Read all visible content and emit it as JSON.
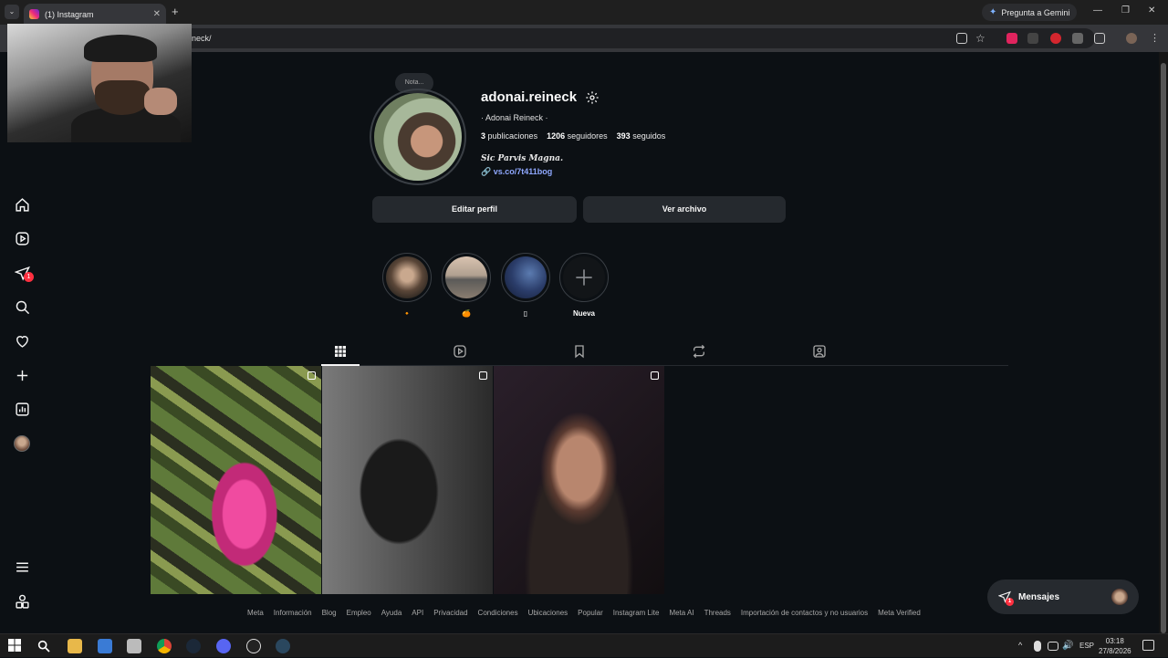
{
  "browser": {
    "tab_title": "(1) Instagram",
    "tab_close": "✕",
    "new_tab": "+",
    "gemini_label": "Pregunta a Gemini",
    "url": "neck/",
    "window_min": "—",
    "window_max": "❐",
    "window_close": "✕"
  },
  "nav": {
    "messages_badge": "1"
  },
  "profile": {
    "note": "Nota...",
    "username": "adonai.reineck",
    "full_name": "· Adonai Reineck ·",
    "posts_count": "3",
    "posts_label": "publicaciones",
    "followers_count": "1206",
    "followers_label": "seguidores",
    "following_count": "393",
    "following_label": "seguidos",
    "bio": "Sic Parvis Magna.",
    "link": "vs.co/7t411bog",
    "edit_button": "Editar perfil",
    "archive_button": "Ver archivo"
  },
  "highlights": [
    {
      "label": "🔸",
      "color": "#e05a2b"
    },
    {
      "label": "🍊",
      "color": "#c77a3a"
    },
    {
      "label": "▯",
      "color": "#ffffff"
    },
    {
      "label": "Nueva",
      "color": "#ffffff"
    }
  ],
  "tabs": [
    "posts",
    "reels",
    "saved",
    "reposts",
    "tagged"
  ],
  "footer": [
    "Meta",
    "Información",
    "Blog",
    "Empleo",
    "Ayuda",
    "API",
    "Privacidad",
    "Condiciones",
    "Ubicaciones",
    "Popular",
    "Instagram Lite",
    "Meta AI",
    "Threads",
    "Importación de contactos y no usuarios",
    "Meta Verified"
  ],
  "messages": {
    "label": "Mensajes",
    "badge": "1"
  },
  "taskbar": {
    "lang": "ESP",
    "time": "03:18",
    "date": "27/8/2026"
  }
}
